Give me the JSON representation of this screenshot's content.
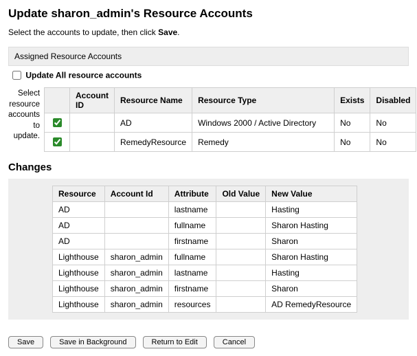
{
  "header": {
    "title": "Update sharon_admin's Resource Accounts",
    "instruction_pre": "Select the accounts to update, then click ",
    "instruction_bold": "Save",
    "instruction_post": "."
  },
  "assigned": {
    "section_title": "Assigned Resource Accounts",
    "update_all_label": "Update All resource accounts",
    "row_label": "Select resource accounts to update.",
    "columns": {
      "cb": "",
      "account_id": "Account ID",
      "resource_name": "Resource Name",
      "resource_type": "Resource Type",
      "exists": "Exists",
      "disabled": "Disabled"
    },
    "rows": [
      {
        "checked": true,
        "account_id": "",
        "resource_name": "AD",
        "resource_type": "Windows 2000 / Active Directory",
        "exists": "No",
        "disabled": "No"
      },
      {
        "checked": true,
        "account_id": "",
        "resource_name": "RemedyResource",
        "resource_type": "Remedy",
        "exists": "No",
        "disabled": "No"
      }
    ]
  },
  "changes": {
    "heading": "Changes",
    "columns": {
      "resource": "Resource",
      "account_id": "Account Id",
      "attribute": "Attribute",
      "old_value": "Old Value",
      "new_value": "New Value"
    },
    "rows": [
      {
        "resource": "AD",
        "account_id": "",
        "attribute": "lastname",
        "old_value": "",
        "new_value": "Hasting"
      },
      {
        "resource": "AD",
        "account_id": "",
        "attribute": "fullname",
        "old_value": "",
        "new_value": "Sharon Hasting"
      },
      {
        "resource": "AD",
        "account_id": "",
        "attribute": "firstname",
        "old_value": "",
        "new_value": "Sharon"
      },
      {
        "resource": "Lighthouse",
        "account_id": "sharon_admin",
        "attribute": "fullname",
        "old_value": "",
        "new_value": "Sharon Hasting"
      },
      {
        "resource": "Lighthouse",
        "account_id": "sharon_admin",
        "attribute": "lastname",
        "old_value": "",
        "new_value": "Hasting"
      },
      {
        "resource": "Lighthouse",
        "account_id": "sharon_admin",
        "attribute": "firstname",
        "old_value": "",
        "new_value": "Sharon"
      },
      {
        "resource": "Lighthouse",
        "account_id": "sharon_admin",
        "attribute": "resources",
        "old_value": "",
        "new_value": "AD RemedyResource"
      }
    ]
  },
  "buttons": {
    "save": "Save",
    "save_bg": "Save in Background",
    "return_edit": "Return to Edit",
    "cancel": "Cancel"
  }
}
